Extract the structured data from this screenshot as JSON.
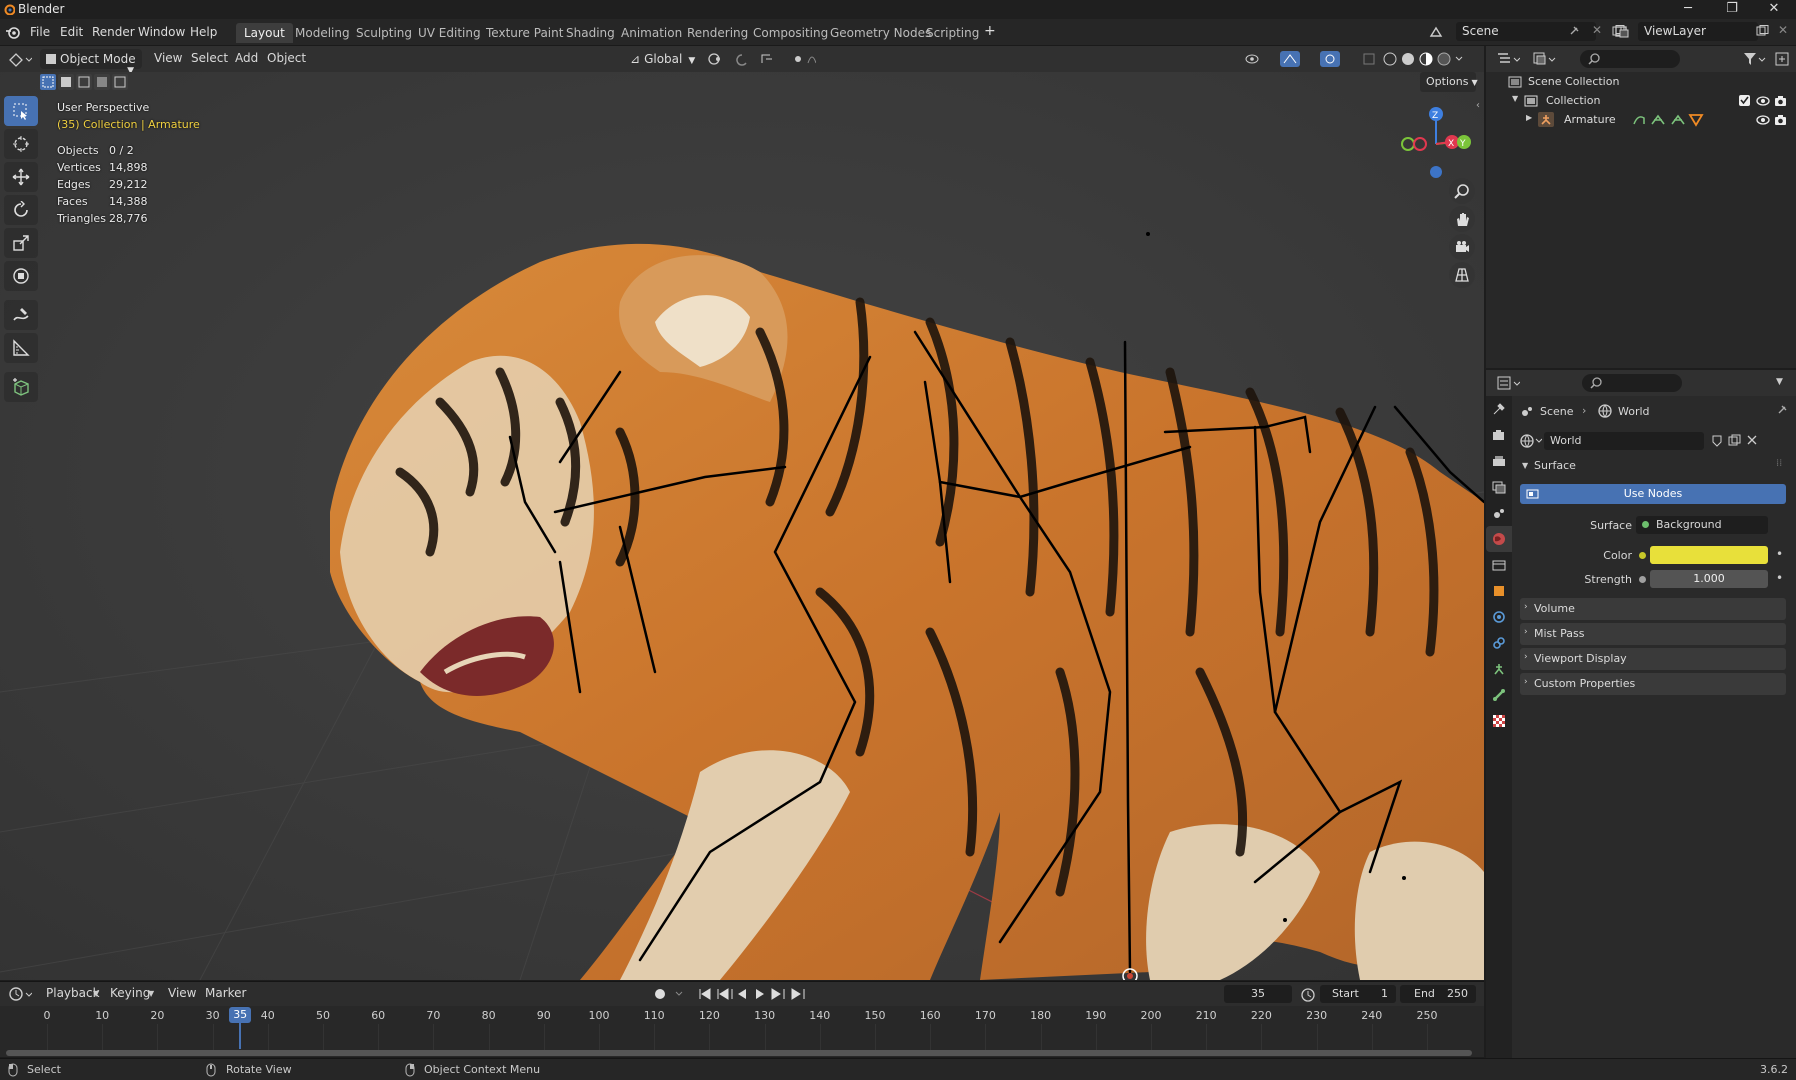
{
  "app": {
    "title": "Blender",
    "version": "3.6.2"
  },
  "menus": [
    "File",
    "Edit",
    "Render",
    "Window",
    "Help"
  ],
  "workspaces": {
    "active": "Layout",
    "tabs": [
      "Layout",
      "Modeling",
      "Sculpting",
      "UV Editing",
      "Texture Paint",
      "Shading",
      "Animation",
      "Rendering",
      "Compositing",
      "Geometry Nodes",
      "Scripting"
    ],
    "add_symbol": "+"
  },
  "scene_field": "Scene",
  "viewlayer_field": "ViewLayer",
  "viewport_header": {
    "mode": "Object Mode",
    "menus": [
      "View",
      "Select",
      "Add",
      "Object"
    ],
    "orientation": "Global",
    "options": "Options"
  },
  "viewport_overlay": {
    "perspective": "User Perspective",
    "collection_info": "(35) Collection | Armature",
    "stats": [
      {
        "label": "Objects",
        "value": "0 / 2"
      },
      {
        "label": "Vertices",
        "value": "14,898"
      },
      {
        "label": "Edges",
        "value": "29,212"
      },
      {
        "label": "Faces",
        "value": "14,388"
      },
      {
        "label": "Triangles",
        "value": "28,776"
      }
    ],
    "gizmo_axes": {
      "z": "Z",
      "x": "X",
      "y": "Y"
    }
  },
  "timeline": {
    "menus": [
      "Playback",
      "Keying",
      "View",
      "Marker"
    ],
    "current_frame": "35",
    "start_label": "Start",
    "start": "1",
    "end_label": "End",
    "end": "250",
    "ticks": [
      "0",
      "10",
      "20",
      "30",
      "40",
      "50",
      "60",
      "70",
      "80",
      "90",
      "100",
      "110",
      "120",
      "130",
      "140",
      "150",
      "160",
      "170",
      "180",
      "190",
      "200",
      "210",
      "220",
      "230",
      "240",
      "250"
    ]
  },
  "statusbar": {
    "items": [
      "Select",
      "Rotate View",
      "Object Context Menu"
    ]
  },
  "outliner": {
    "rows": [
      {
        "label": "Scene Collection"
      },
      {
        "label": "Collection"
      },
      {
        "label": "Armature"
      }
    ]
  },
  "properties": {
    "breadcrumb": {
      "scene": "Scene",
      "world": "World"
    },
    "world_name": "World",
    "surface_section": "Surface",
    "use_nodes": "Use Nodes",
    "surface_label": "Surface",
    "surface_value": "Background",
    "color_label": "Color",
    "strength_label": "Strength",
    "strength_value": "1.000",
    "panels": [
      "Volume",
      "Mist Pass",
      "Viewport Display",
      "Custom Properties"
    ]
  },
  "colors": {
    "accent": "#4772b3",
    "overlay_yellow": "#f0d040",
    "axis_x": "#e0384f",
    "axis_y": "#7bc43a",
    "axis_z": "#3e7fe0",
    "world_color": "#e8e03a"
  }
}
